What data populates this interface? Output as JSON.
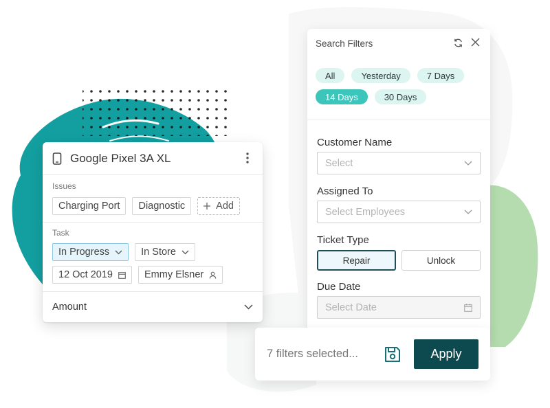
{
  "device_card": {
    "title": "Google Pixel 3A XL",
    "header_icon": "phone-icon",
    "menu_icon": "kebab-icon",
    "issues": {
      "label": "Issues",
      "chips": [
        "Charging Port",
        "Diagnostic"
      ],
      "add_label": "Add"
    },
    "task": {
      "label": "Task",
      "status": "In Progress",
      "location": "In Store",
      "date": "12 Oct 2019",
      "assignee": "Emmy Elsner"
    },
    "amount_label": "Amount"
  },
  "filters": {
    "title": "Search Filters",
    "quick_ranges": [
      {
        "label": "All",
        "selected": false
      },
      {
        "label": "Yesterday",
        "selected": false
      },
      {
        "label": "7 Days",
        "selected": false
      },
      {
        "label": "14 Days",
        "selected": true
      },
      {
        "label": "30 Days",
        "selected": false
      }
    ],
    "customer_name": {
      "label": "Customer Name",
      "placeholder": "Select"
    },
    "assigned_to": {
      "label": "Assigned To",
      "placeholder": "Select Employees"
    },
    "ticket_type": {
      "label": "Ticket Type",
      "options": [
        "Repair",
        "Unlock"
      ],
      "selected": "Repair"
    },
    "due_date": {
      "label": "Due Date",
      "placeholder": "Select Date"
    }
  },
  "footer": {
    "count_text": "7 filters selected...",
    "apply_label": "Apply"
  },
  "colors": {
    "teal_blob": "#139fa0",
    "green_blob": "#b4dcae",
    "pill_bg": "#dcf5f1",
    "pill_selected": "#3cc5bb",
    "apply_bg": "#0d4a50",
    "active_chip_bg": "#e5f5fb"
  }
}
